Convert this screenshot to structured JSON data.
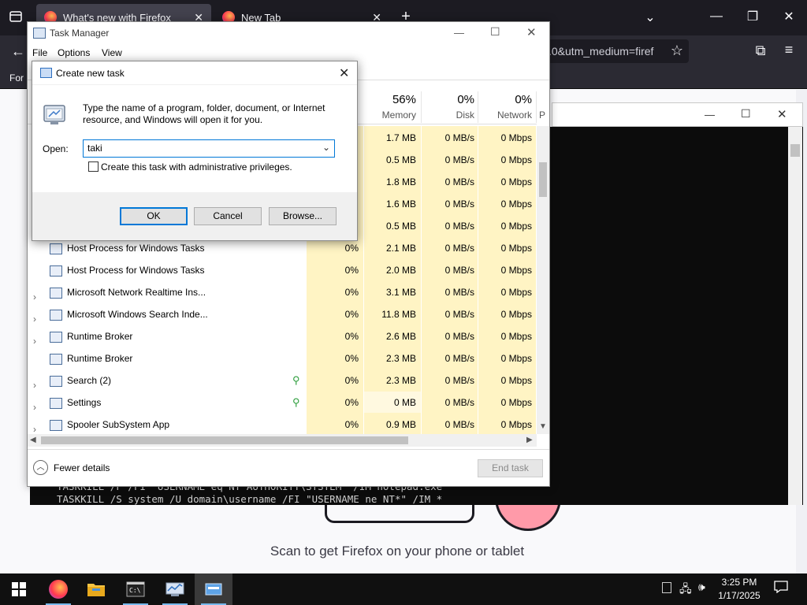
{
  "firefox": {
    "tabs": [
      {
        "label": "What's new with Firefox",
        "close": "✕"
      },
      {
        "label": "New Tab",
        "close": "✕"
      }
    ],
    "new_tab": "+",
    "url_visible": ".0&utm_medium=firef",
    "bookmark_text": "For",
    "page_caption": "Scan to get Firefox on your phone or tablet"
  },
  "console": {
    "lines": [
      "TASKKILL /F /FI \"USERNAME eq NT AUTHORITY\\SYSTEM\" /IM notepad.exe",
      "TASKKILL /S system /U domain\\username /FI \"USERNAME ne NT*\" /IM *"
    ]
  },
  "task_manager": {
    "title": "Task Manager",
    "menu": [
      "File",
      "Options",
      "View"
    ],
    "headers": [
      {
        "pct": "56%",
        "label": "Memory"
      },
      {
        "pct": "0%",
        "label": "Disk"
      },
      {
        "pct": "0%",
        "label": "Network"
      },
      {
        "pct": "",
        "label": "P"
      }
    ],
    "hidden_rows": [
      {
        "memory": "1.7 MB",
        "disk": "0 MB/s",
        "network": "0 Mbps"
      },
      {
        "memory": "0.5 MB",
        "disk": "0 MB/s",
        "network": "0 Mbps"
      },
      {
        "memory": "1.8 MB",
        "disk": "0 MB/s",
        "network": "0 Mbps"
      },
      {
        "memory": "1.6 MB",
        "disk": "0 MB/s",
        "network": "0 Mbps"
      },
      {
        "memory": "0.5 MB",
        "disk": "0 MB/s",
        "network": "0 Mbps"
      }
    ],
    "rows": [
      {
        "name": "Host Process for Windows Tasks",
        "cpu": "0%",
        "memory": "2.1 MB",
        "disk": "0 MB/s",
        "network": "0 Mbps",
        "expand": false,
        "leaf": false
      },
      {
        "name": "Host Process for Windows Tasks",
        "cpu": "0%",
        "memory": "2.0 MB",
        "disk": "0 MB/s",
        "network": "0 Mbps",
        "expand": false,
        "leaf": false
      },
      {
        "name": "Microsoft Network Realtime Ins...",
        "cpu": "0%",
        "memory": "3.1 MB",
        "disk": "0 MB/s",
        "network": "0 Mbps",
        "expand": true,
        "leaf": false
      },
      {
        "name": "Microsoft Windows Search Inde...",
        "cpu": "0%",
        "memory": "11.8 MB",
        "disk": "0 MB/s",
        "network": "0 Mbps",
        "expand": true,
        "leaf": false
      },
      {
        "name": "Runtime Broker",
        "cpu": "0%",
        "memory": "2.6 MB",
        "disk": "0 MB/s",
        "network": "0 Mbps",
        "expand": true,
        "leaf": false
      },
      {
        "name": "Runtime Broker",
        "cpu": "0%",
        "memory": "2.3 MB",
        "disk": "0 MB/s",
        "network": "0 Mbps",
        "expand": false,
        "leaf": false
      },
      {
        "name": "Search (2)",
        "cpu": "0%",
        "memory": "2.3 MB",
        "disk": "0 MB/s",
        "network": "0 Mbps",
        "expand": true,
        "leaf": true
      },
      {
        "name": "Settings",
        "cpu": "0%",
        "memory": "0 MB",
        "disk": "0 MB/s",
        "network": "0 Mbps",
        "expand": true,
        "leaf": true
      },
      {
        "name": "Spooler SubSystem App",
        "cpu": "0%",
        "memory": "0.9 MB",
        "disk": "0 MB/s",
        "network": "0 Mbps",
        "expand": true,
        "leaf": false
      }
    ],
    "fewer_details": "Fewer details",
    "end_task": "End task"
  },
  "dialog": {
    "title": "Create new task",
    "description": "Type the name of a program, folder, document, or Internet resource, and Windows will open it for you.",
    "open_label": "Open:",
    "open_value": "taki",
    "admin_label": "Create this task with administrative privileges.",
    "ok": "OK",
    "cancel": "Cancel",
    "browse": "Browse..."
  },
  "taskbar": {
    "time": "3:25 PM",
    "date": "1/17/2025"
  },
  "colors": {
    "firefox_dark": "#1c1b22",
    "firefox_toolbar": "#2b2a33",
    "tm_highlight": "#fff4c4",
    "accent_blue": "#0078d7",
    "eco_green": "#2e9e3d"
  }
}
